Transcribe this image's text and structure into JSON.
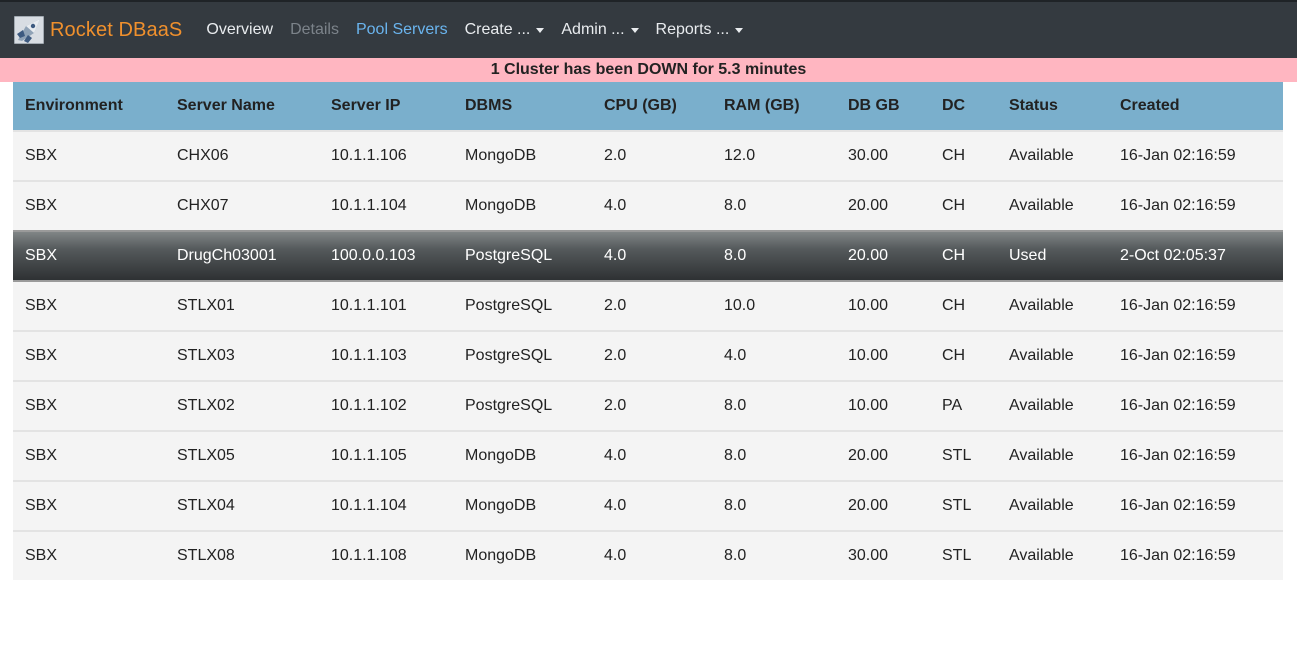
{
  "brand": {
    "name": "Rocket DBaaS"
  },
  "nav": {
    "overview": "Overview",
    "details": "Details",
    "pool_servers": "Pool Servers",
    "create": "Create ...",
    "admin": "Admin ...",
    "reports": "Reports ..."
  },
  "alert": {
    "message": "1 Cluster has been DOWN for 5.3 minutes"
  },
  "colors": {
    "navbar": "#343a40",
    "brand": "#f0902d",
    "active_nav": "#6ab4ee",
    "alert_bg": "#ffb6c1",
    "table_header": "#7aafcc"
  },
  "table": {
    "headers": [
      "Environment",
      "Server Name",
      "Server IP",
      "DBMS",
      "CPU (GB)",
      "RAM (GB)",
      "DB GB",
      "DC",
      "Status",
      "Created"
    ],
    "rows": [
      [
        "SBX",
        "CHX06",
        "10.1.1.106",
        "MongoDB",
        "2.0",
        "12.0",
        "30.00",
        "CH",
        "Available",
        "16-Jan 02:16:59"
      ],
      [
        "SBX",
        "CHX07",
        "10.1.1.104",
        "MongoDB",
        "4.0",
        "8.0",
        "20.00",
        "CH",
        "Available",
        "16-Jan 02:16:59"
      ],
      [
        "SBX",
        "DrugCh03001",
        "100.0.0.103",
        "PostgreSQL",
        "4.0",
        "8.0",
        "20.00",
        "CH",
        "Used",
        "2-Oct 02:05:37"
      ],
      [
        "SBX",
        "STLX01",
        "10.1.1.101",
        "PostgreSQL",
        "2.0",
        "10.0",
        "10.00",
        "CH",
        "Available",
        "16-Jan 02:16:59"
      ],
      [
        "SBX",
        "STLX03",
        "10.1.1.103",
        "PostgreSQL",
        "2.0",
        "4.0",
        "10.00",
        "CH",
        "Available",
        "16-Jan 02:16:59"
      ],
      [
        "SBX",
        "STLX02",
        "10.1.1.102",
        "PostgreSQL",
        "2.0",
        "8.0",
        "10.00",
        "PA",
        "Available",
        "16-Jan 02:16:59"
      ],
      [
        "SBX",
        "STLX05",
        "10.1.1.105",
        "MongoDB",
        "4.0",
        "8.0",
        "20.00",
        "STL",
        "Available",
        "16-Jan 02:16:59"
      ],
      [
        "SBX",
        "STLX04",
        "10.1.1.104",
        "MongoDB",
        "4.0",
        "8.0",
        "20.00",
        "STL",
        "Available",
        "16-Jan 02:16:59"
      ],
      [
        "SBX",
        "STLX08",
        "10.1.1.108",
        "MongoDB",
        "4.0",
        "8.0",
        "30.00",
        "STL",
        "Available",
        "16-Jan 02:16:59"
      ]
    ],
    "selected_row": 2
  }
}
